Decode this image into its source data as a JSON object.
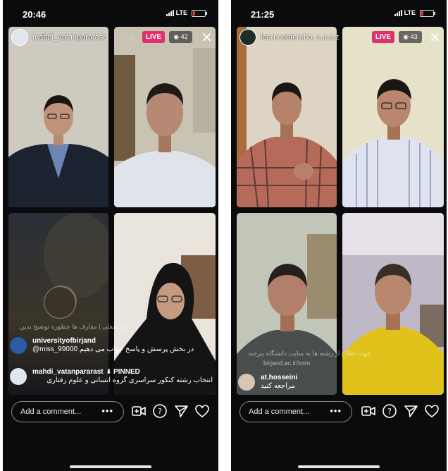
{
  "left": {
    "time": "20:46",
    "carrier": "LTE",
    "host": "mahdi_vatanpararast",
    "live_badge": "LIVE",
    "viewers": "42",
    "faded_comment": "... ایده شغلی | معارف ها چطوره توضیح بدین",
    "comments": [
      {
        "user": "universityofbirjand",
        "text": "@miss_99000 در بخش پرسش و پاسخ جواب می دهیم"
      },
      {
        "user": "mahdi_vatanpararast",
        "pinned": "PINNED",
        "text": "انتخاب رشته کنکور سراسری گروه انسانی و علوم رفتاری"
      }
    ],
    "comment_placeholder": "Add a comment...",
    "dots": "•••"
  },
  "right": {
    "time": "21:25",
    "carrier": "LTE",
    "host": "learncentereho, s.a.z.z",
    "live_badge": "LIVE",
    "viewers": "43",
    "faded_comment": "جهت اطلاع از رشته ها به سایت دانشگاه بیرجند",
    "faded_link": "birjand.ac.ir/intro",
    "comments": [
      {
        "user": "at.hosseini",
        "text": "مراجعه کنید"
      }
    ],
    "comment_placeholder": "Add a comment...",
    "dots": "•••"
  },
  "icons": [
    "video-camera-icon",
    "question-icon",
    "paper-plane-icon",
    "heart-icon",
    "eye-icon",
    "close-icon",
    "chevron-down-icon",
    "pin-icon"
  ],
  "colors": {
    "live": "#e1306c",
    "background": "#0b0b0d"
  }
}
